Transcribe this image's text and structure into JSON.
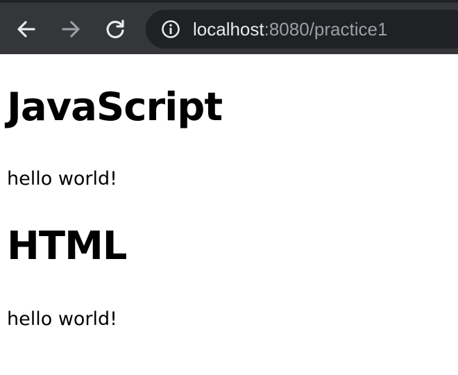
{
  "browser": {
    "url_host": "localhost",
    "url_rest": ":8080/practice1",
    "icons": {
      "back": "arrow-left-icon",
      "forward": "arrow-right-icon",
      "reload": "reload-icon",
      "site_info": "info-icon"
    },
    "colors": {
      "toolbar": "#35363a",
      "omnibox": "#202124",
      "icon_active": "#e8eaed",
      "icon_disabled": "#9aa0a6"
    }
  },
  "page": {
    "sections": [
      {
        "heading": "JavaScript",
        "text": "hello world!"
      },
      {
        "heading": "HTML",
        "text": "hello world!"
      }
    ]
  }
}
